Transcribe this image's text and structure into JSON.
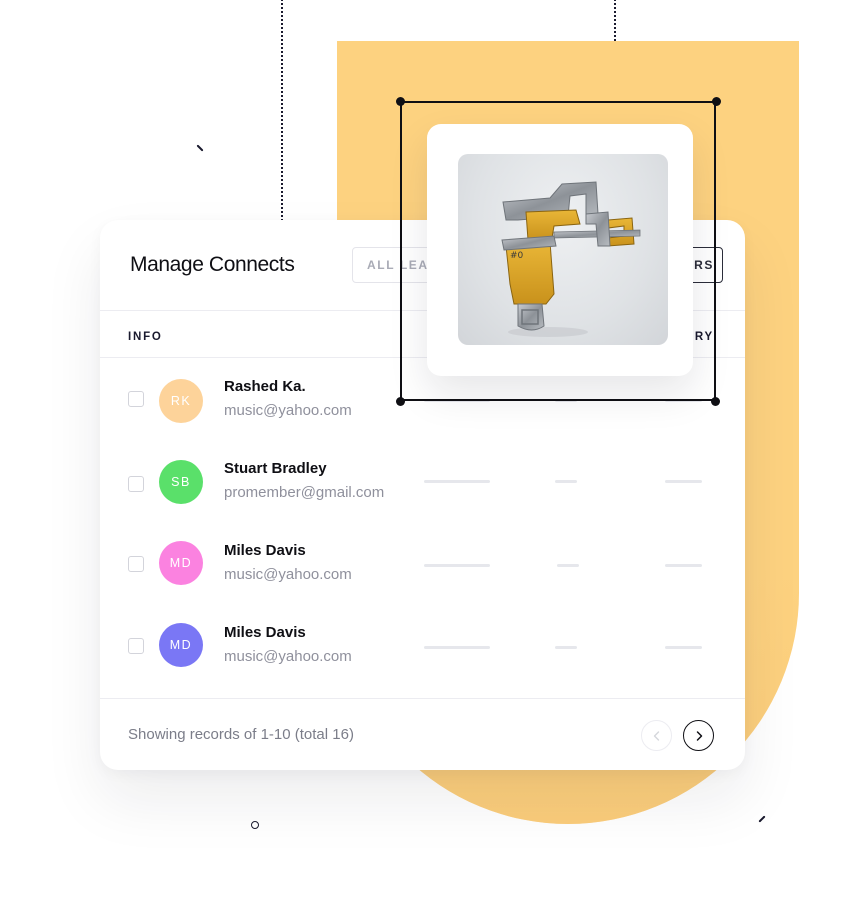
{
  "colors": {
    "accent": "#fdd280",
    "dark": "#0f0f14"
  },
  "card": {
    "title": "Manage Connects",
    "filters": {
      "all_leads": "ALL LEADS",
      "filters": "FILTERS"
    },
    "columns": {
      "info": "INFO",
      "country": "COUNTRY"
    },
    "rows": [
      {
        "initials": "RK",
        "name": "Rashed Ka.",
        "email": "music@yahoo.com",
        "avatar_color": "#fdd39a"
      },
      {
        "initials": "SB",
        "name": "Stuart Bradley",
        "email": "promember@gmail.com",
        "avatar_color": "#5ae06a"
      },
      {
        "initials": "MD",
        "name": "Miles Davis",
        "email": "music@yahoo.com",
        "avatar_color": "#fb82e0"
      },
      {
        "initials": "MD",
        "name": "Miles Davis",
        "email": "music@yahoo.com",
        "avatar_color": "#7a77f5"
      }
    ],
    "footer": {
      "records_text": "Showing records of 1-10 (total 16)",
      "prev_icon": "chevron-left-icon",
      "next_icon": "chevron-right-icon"
    }
  },
  "floating_card": {
    "image_subject": "yellow-and-chrome mechanical sculpture"
  }
}
